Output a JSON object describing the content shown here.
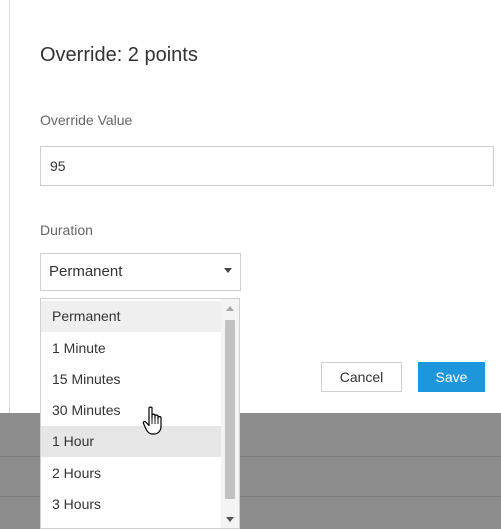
{
  "dialog": {
    "title": "Override: 2 points",
    "override_label": "Override Value",
    "override_value": "95",
    "duration_label": "Duration",
    "duration_selected": "Permanent",
    "cancel_label": "Cancel",
    "save_label": "Save"
  },
  "dropdown": {
    "options": [
      {
        "label": "Permanent",
        "state": "selected"
      },
      {
        "label": "1 Minute",
        "state": ""
      },
      {
        "label": "15 Minutes",
        "state": ""
      },
      {
        "label": "30 Minutes",
        "state": ""
      },
      {
        "label": "1 Hour",
        "state": "hovered"
      },
      {
        "label": "2 Hours",
        "state": ""
      },
      {
        "label": "3 Hours",
        "state": ""
      }
    ]
  },
  "colors": {
    "accent": "#1e96dc",
    "backdrop": "#8c8c8c"
  },
  "icons": {
    "caret": "chevron-down-icon",
    "cursor": "hand-pointer-icon"
  }
}
